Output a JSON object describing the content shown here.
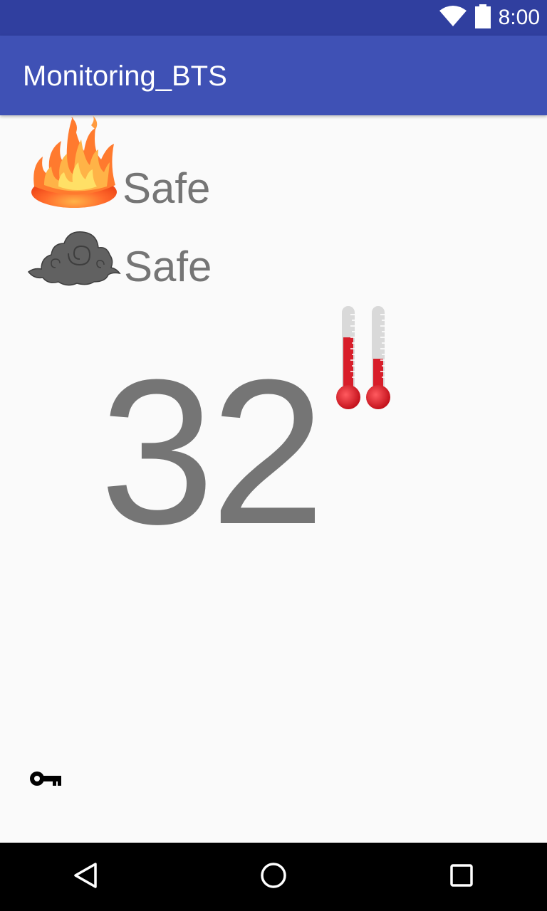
{
  "status_bar": {
    "time": "8:00",
    "wifi_icon": "wifi-icon",
    "battery_icon": "battery-icon"
  },
  "app_bar": {
    "title": "Monitoring_BTS"
  },
  "sensors": {
    "fire": {
      "icon": "fire-icon",
      "status": "Safe"
    },
    "smoke": {
      "icon": "smoke-icon",
      "status": "Safe"
    }
  },
  "temperature": {
    "value": "32",
    "icon": "thermometer-icon"
  },
  "footer": {
    "icon": "key-icon"
  },
  "nav_bar": {
    "back_icon": "back-icon",
    "home_icon": "home-icon",
    "recents_icon": "recents-icon"
  },
  "colors": {
    "status_bar": "#303f9f",
    "app_bar": "#3f51b5",
    "text_gray": "#757575",
    "background": "#fafafa",
    "thermometer_red": "#d81e2a"
  }
}
